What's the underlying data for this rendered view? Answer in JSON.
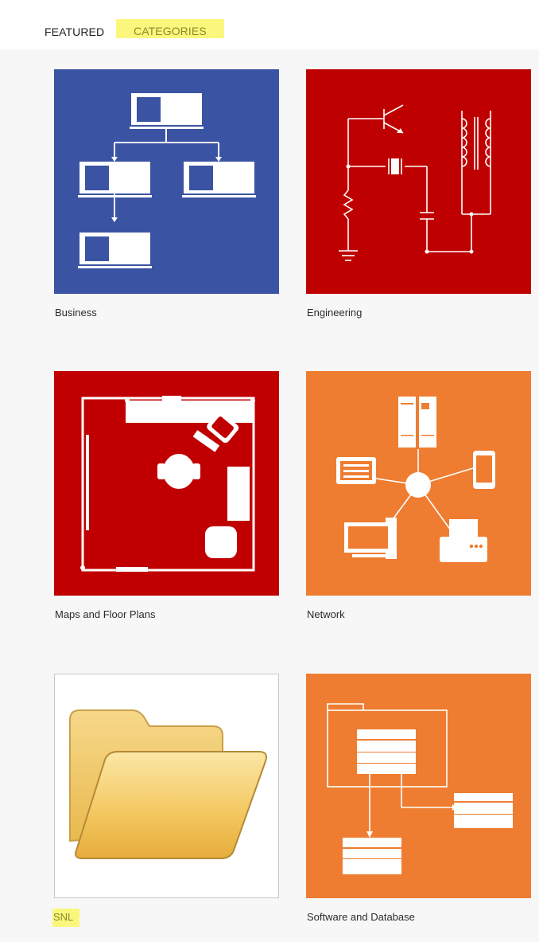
{
  "tabs": {
    "featured": "FEATURED",
    "categories": "CATEGORIES"
  },
  "categories": [
    {
      "label": "Business",
      "color": "#3b53a3"
    },
    {
      "label": "Engineering",
      "color": "#bf0000"
    },
    {
      "label": "Maps and Floor Plans",
      "color": "#c00000"
    },
    {
      "label": "Network",
      "color": "#ee7d31"
    },
    {
      "label": "SNL",
      "color": "#ffffff"
    },
    {
      "label": "Software and Database",
      "color": "#ee7d31"
    }
  ],
  "highlight_color": "#fbf77c"
}
